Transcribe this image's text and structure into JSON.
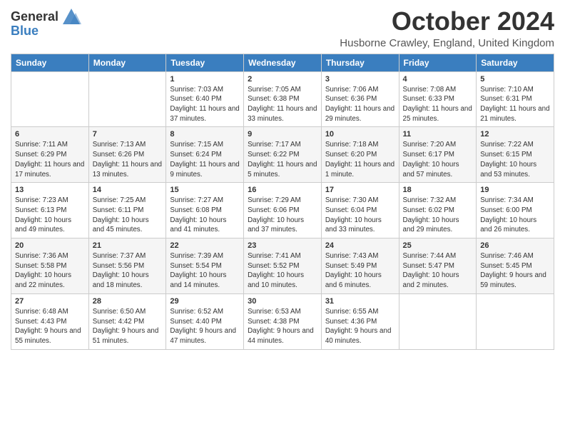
{
  "logo": {
    "text_general": "General",
    "text_blue": "Blue"
  },
  "header": {
    "month_title": "October 2024",
    "location": "Husborne Crawley, England, United Kingdom"
  },
  "days_of_week": [
    "Sunday",
    "Monday",
    "Tuesday",
    "Wednesday",
    "Thursday",
    "Friday",
    "Saturday"
  ],
  "weeks": [
    [
      {
        "day": "",
        "info": ""
      },
      {
        "day": "",
        "info": ""
      },
      {
        "day": "1",
        "info": "Sunrise: 7:03 AM\nSunset: 6:40 PM\nDaylight: 11 hours and 37 minutes."
      },
      {
        "day": "2",
        "info": "Sunrise: 7:05 AM\nSunset: 6:38 PM\nDaylight: 11 hours and 33 minutes."
      },
      {
        "day": "3",
        "info": "Sunrise: 7:06 AM\nSunset: 6:36 PM\nDaylight: 11 hours and 29 minutes."
      },
      {
        "day": "4",
        "info": "Sunrise: 7:08 AM\nSunset: 6:33 PM\nDaylight: 11 hours and 25 minutes."
      },
      {
        "day": "5",
        "info": "Sunrise: 7:10 AM\nSunset: 6:31 PM\nDaylight: 11 hours and 21 minutes."
      }
    ],
    [
      {
        "day": "6",
        "info": "Sunrise: 7:11 AM\nSunset: 6:29 PM\nDaylight: 11 hours and 17 minutes."
      },
      {
        "day": "7",
        "info": "Sunrise: 7:13 AM\nSunset: 6:26 PM\nDaylight: 11 hours and 13 minutes."
      },
      {
        "day": "8",
        "info": "Sunrise: 7:15 AM\nSunset: 6:24 PM\nDaylight: 11 hours and 9 minutes."
      },
      {
        "day": "9",
        "info": "Sunrise: 7:17 AM\nSunset: 6:22 PM\nDaylight: 11 hours and 5 minutes."
      },
      {
        "day": "10",
        "info": "Sunrise: 7:18 AM\nSunset: 6:20 PM\nDaylight: 11 hours and 1 minute."
      },
      {
        "day": "11",
        "info": "Sunrise: 7:20 AM\nSunset: 6:17 PM\nDaylight: 10 hours and 57 minutes."
      },
      {
        "day": "12",
        "info": "Sunrise: 7:22 AM\nSunset: 6:15 PM\nDaylight: 10 hours and 53 minutes."
      }
    ],
    [
      {
        "day": "13",
        "info": "Sunrise: 7:23 AM\nSunset: 6:13 PM\nDaylight: 10 hours and 49 minutes."
      },
      {
        "day": "14",
        "info": "Sunrise: 7:25 AM\nSunset: 6:11 PM\nDaylight: 10 hours and 45 minutes."
      },
      {
        "day": "15",
        "info": "Sunrise: 7:27 AM\nSunset: 6:08 PM\nDaylight: 10 hours and 41 minutes."
      },
      {
        "day": "16",
        "info": "Sunrise: 7:29 AM\nSunset: 6:06 PM\nDaylight: 10 hours and 37 minutes."
      },
      {
        "day": "17",
        "info": "Sunrise: 7:30 AM\nSunset: 6:04 PM\nDaylight: 10 hours and 33 minutes."
      },
      {
        "day": "18",
        "info": "Sunrise: 7:32 AM\nSunset: 6:02 PM\nDaylight: 10 hours and 29 minutes."
      },
      {
        "day": "19",
        "info": "Sunrise: 7:34 AM\nSunset: 6:00 PM\nDaylight: 10 hours and 26 minutes."
      }
    ],
    [
      {
        "day": "20",
        "info": "Sunrise: 7:36 AM\nSunset: 5:58 PM\nDaylight: 10 hours and 22 minutes."
      },
      {
        "day": "21",
        "info": "Sunrise: 7:37 AM\nSunset: 5:56 PM\nDaylight: 10 hours and 18 minutes."
      },
      {
        "day": "22",
        "info": "Sunrise: 7:39 AM\nSunset: 5:54 PM\nDaylight: 10 hours and 14 minutes."
      },
      {
        "day": "23",
        "info": "Sunrise: 7:41 AM\nSunset: 5:52 PM\nDaylight: 10 hours and 10 minutes."
      },
      {
        "day": "24",
        "info": "Sunrise: 7:43 AM\nSunset: 5:49 PM\nDaylight: 10 hours and 6 minutes."
      },
      {
        "day": "25",
        "info": "Sunrise: 7:44 AM\nSunset: 5:47 PM\nDaylight: 10 hours and 2 minutes."
      },
      {
        "day": "26",
        "info": "Sunrise: 7:46 AM\nSunset: 5:45 PM\nDaylight: 9 hours and 59 minutes."
      }
    ],
    [
      {
        "day": "27",
        "info": "Sunrise: 6:48 AM\nSunset: 4:43 PM\nDaylight: 9 hours and 55 minutes."
      },
      {
        "day": "28",
        "info": "Sunrise: 6:50 AM\nSunset: 4:42 PM\nDaylight: 9 hours and 51 minutes."
      },
      {
        "day": "29",
        "info": "Sunrise: 6:52 AM\nSunset: 4:40 PM\nDaylight: 9 hours and 47 minutes."
      },
      {
        "day": "30",
        "info": "Sunrise: 6:53 AM\nSunset: 4:38 PM\nDaylight: 9 hours and 44 minutes."
      },
      {
        "day": "31",
        "info": "Sunrise: 6:55 AM\nSunset: 4:36 PM\nDaylight: 9 hours and 40 minutes."
      },
      {
        "day": "",
        "info": ""
      },
      {
        "day": "",
        "info": ""
      }
    ]
  ]
}
